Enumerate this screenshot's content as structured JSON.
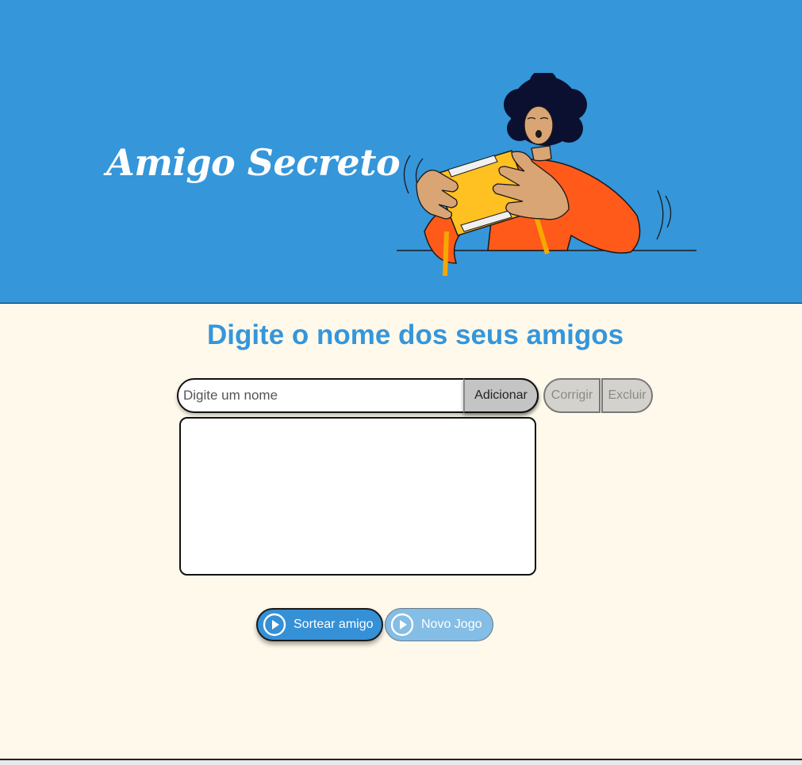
{
  "header": {
    "title": "Amigo Secreto",
    "illustration_icon": "person-shaking-gift-box-illustration"
  },
  "main": {
    "heading": "Digite o nome dos seus amigos",
    "name_input": {
      "value": "",
      "placeholder": "Digite um nome"
    },
    "add_button": "Adicionar",
    "fix_button": "Corrigir",
    "delete_button": "Excluir",
    "friends_list": [],
    "draw_button": "Sortear amigo",
    "new_game_button": "Novo Jogo"
  },
  "colors": {
    "banner_bg": "#3596da",
    "page_bg": "#fff9eb",
    "heading": "#3596da",
    "primary_button": "#3590d6",
    "secondary_button": "#84bde5",
    "disabled_button": "#d4d2cc"
  },
  "icons": {
    "draw": "play-circle-icon",
    "new_game": "play-circle-icon"
  }
}
